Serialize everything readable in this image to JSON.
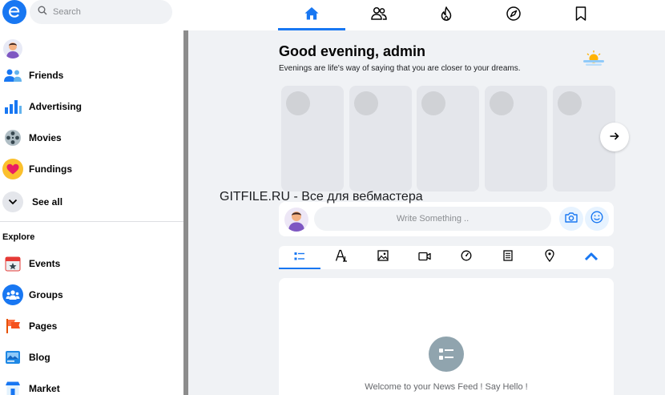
{
  "header": {
    "search_placeholder": "Search",
    "tabs": [
      {
        "name": "home",
        "active": true
      },
      {
        "name": "friends",
        "active": false
      },
      {
        "name": "trending",
        "active": false
      },
      {
        "name": "explore",
        "active": false
      },
      {
        "name": "saved",
        "active": false
      }
    ]
  },
  "sidebar": {
    "items": [
      {
        "label": "Friends",
        "icon": "friends-icon"
      },
      {
        "label": "Advertising",
        "icon": "bar-chart-icon"
      },
      {
        "label": "Movies",
        "icon": "film-reel-icon"
      },
      {
        "label": "Fundings",
        "icon": "heart-icon"
      }
    ],
    "see_all": "See all",
    "explore_heading": "Explore",
    "explore_items": [
      {
        "label": "Events",
        "icon": "calendar-star-icon"
      },
      {
        "label": "Groups",
        "icon": "groups-icon"
      },
      {
        "label": "Pages",
        "icon": "flag-icon"
      },
      {
        "label": "Blog",
        "icon": "blog-icon"
      },
      {
        "label": "Market",
        "icon": "market-icon"
      }
    ]
  },
  "main": {
    "greeting_title": "Good evening, admin",
    "greeting_subtitle": "Evenings are life's way of saying that you are closer to your dreams.",
    "composer_placeholder": "Write Something ..",
    "welcome_text": "Welcome to your News Feed ! Say Hello !"
  },
  "watermark": "GITFILE.RU - Все для вебмастера",
  "colors": {
    "accent": "#1877f2",
    "background": "#f0f2f5",
    "card": "#ffffff"
  }
}
